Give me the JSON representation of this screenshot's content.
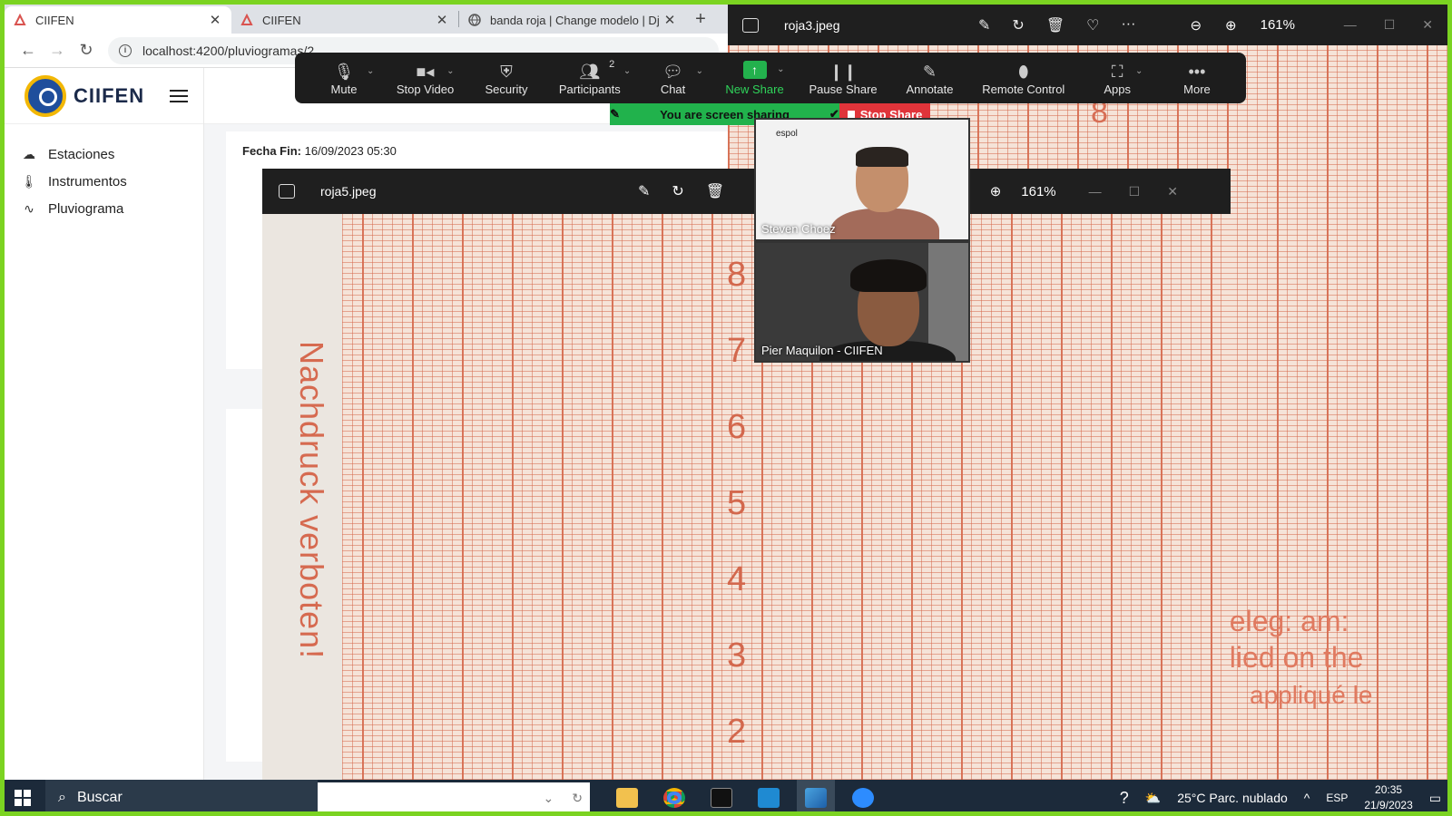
{
  "browser": {
    "tabs": [
      {
        "label": "CIIFEN",
        "active": true
      },
      {
        "label": "CIIFEN",
        "active": false
      },
      {
        "label": "banda roja | Change modelo | Dj",
        "active": false
      }
    ],
    "url": "localhost:4200/pluviogramas/2"
  },
  "app": {
    "brand": "CIIFEN",
    "menu": [
      {
        "label": "Estaciones",
        "icon": "cloud-rain-icon"
      },
      {
        "label": "Instrumentos",
        "icon": "thermometer-icon"
      },
      {
        "label": "Pluviograma",
        "icon": "activity-icon"
      }
    ],
    "fecha_fin_label": "Fecha Fin:",
    "fecha_fin_value": "16/09/2023 05:30"
  },
  "viewer_right": {
    "filename": "roja3.jpeg",
    "zoom": "161%",
    "number": "8",
    "stamp_lines": [
      "geleg: am:",
      "plied on the",
      "appliqué le"
    ]
  },
  "viewer_front": {
    "filename": "roja5.jpeg",
    "zoom": "161%",
    "vertical_text": "Nachdruck verboten!",
    "axis_numbers": [
      "8",
      "7",
      "6",
      "5",
      "4",
      "3",
      "2"
    ]
  },
  "zoom_toolbar": {
    "buttons": [
      {
        "label": "Mute",
        "icon": "microphone-icon"
      },
      {
        "label": "Stop Video",
        "icon": "video-camera-icon"
      },
      {
        "label": "Security",
        "icon": "shield-icon"
      },
      {
        "label": "Participants",
        "icon": "participants-icon",
        "count": "2"
      },
      {
        "label": "Chat",
        "icon": "chat-icon"
      },
      {
        "label": "New Share",
        "icon": "share-arrow-icon"
      },
      {
        "label": "Pause Share",
        "icon": "pause-icon"
      },
      {
        "label": "Annotate",
        "icon": "pencil-icon"
      },
      {
        "label": "Remote Control",
        "icon": "mouse-icon"
      },
      {
        "label": "Apps",
        "icon": "apps-icon"
      },
      {
        "label": "More",
        "icon": "more-icon"
      }
    ],
    "share_banner": "You are screen sharing",
    "stop_share": "Stop Share"
  },
  "participants": [
    {
      "name": "Steven Choez",
      "overlay_text": "espol"
    },
    {
      "name": "Pier Maquilon - CIIFEN"
    }
  ],
  "taskbar": {
    "search": "Buscar",
    "weather": "25°C  Parc. nublado",
    "language": "ESP",
    "time": "20:35",
    "date": "21/9/2023"
  }
}
